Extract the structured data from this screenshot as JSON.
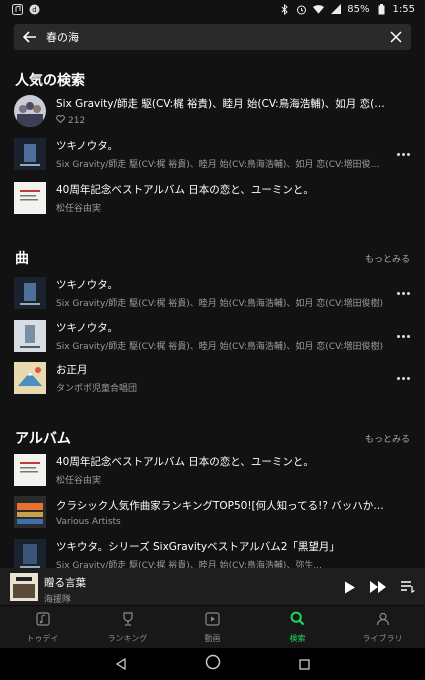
{
  "status": {
    "battery": "85%",
    "time": "1:55"
  },
  "search": {
    "query": "春の海"
  },
  "popular": {
    "title": "人気の検索",
    "items": [
      {
        "title": "Six Gravity/師走 駆(CV:梶 裕貴)、睦月 始(CV:鳥海浩輔)、如月 恋(CV:増田...",
        "subtitle": "212"
      },
      {
        "title": "ツキノウタ。",
        "subtitle": "Six Gravity/師走 駆(CV:梶 裕貴)、睦月 始(CV:鳥海浩輔)、如月 恋(CV:増田俊樹)、弥生 春(CV:前野智昭)"
      },
      {
        "title": "40周年記念ベストアルバム 日本の恋と、ユーミンと。",
        "subtitle": "松任谷由実"
      }
    ]
  },
  "songs": {
    "title": "曲",
    "more": "もっとみる",
    "items": [
      {
        "title": "ツキノウタ。",
        "subtitle": "Six Gravity/師走 駆(CV:梶 裕貴)、睦月 始(CV:鳥海浩輔)、如月 恋(CV:増田俊樹)"
      },
      {
        "title": "ツキノウタ。",
        "subtitle": "Six Gravity/師走 駆(CV:梶 裕貴)、睦月 始(CV:鳥海浩輔)、如月 恋(CV:増田俊樹)"
      },
      {
        "title": "お正月",
        "subtitle": "タンポポ児童合唱団"
      }
    ]
  },
  "albums": {
    "title": "アルバム",
    "more": "もっとみる",
    "items": [
      {
        "title": "40周年記念ベストアルバム 日本の恋と、ユーミンと。",
        "subtitle": "松任谷由実"
      },
      {
        "title": "クラシック人気作曲家ランキングTOP50![何人知ってる!? バッハからピア...",
        "subtitle": "Various Artists"
      },
      {
        "title": "ツキウタ。シリーズ SixGravityベストアルバム2「黒望月」",
        "subtitle": "Six Gravity/師走 駆(CV:梶 裕貴)、睦月 始(CV:鳥海浩輔)、弥生..."
      }
    ]
  },
  "player": {
    "title": "贈る言葉",
    "artist": "海援隊"
  },
  "nav": [
    {
      "label": "トゥデイ"
    },
    {
      "label": "ランキング"
    },
    {
      "label": "動画"
    },
    {
      "label": "検索"
    },
    {
      "label": "ライブラリ"
    }
  ],
  "colors": {
    "accent": "#1ed760",
    "background": "#121212",
    "surface": "#2a2a2a"
  }
}
